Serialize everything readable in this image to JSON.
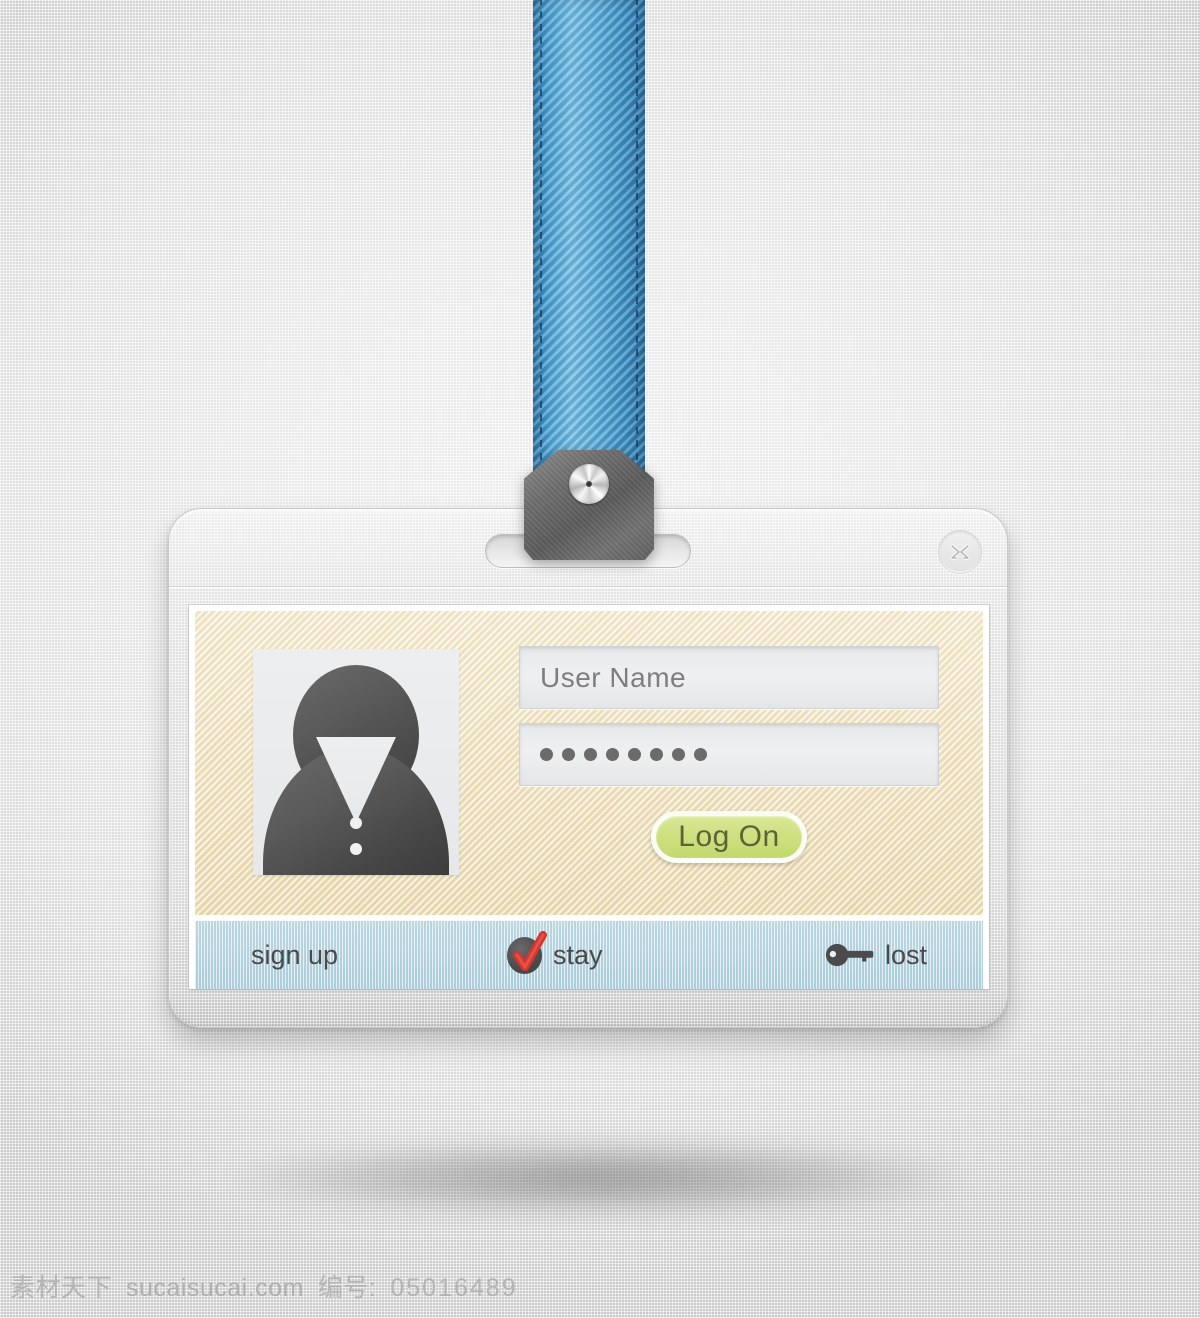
{
  "window": {
    "close_label": "×",
    "close_icon": "close-x-icon",
    "slot_label": "card-slot"
  },
  "lanyard": {
    "color": "#4ba3d8",
    "clip_color": "#6e6e6e",
    "rivet_color": "#e8e8e8"
  },
  "form": {
    "panel_color": "#f3e7c8",
    "avatar_alt": "default user avatar",
    "username": {
      "value": "",
      "placeholder": "User Name"
    },
    "password": {
      "value": "",
      "placeholder": "",
      "masked_char": "•",
      "masked_length": 8
    },
    "submit": {
      "label": "Log On",
      "color": "#cde07f",
      "text_color": "#5d6336"
    }
  },
  "footer": {
    "bar_color": "#c8e0e9",
    "items": [
      {
        "label": "sign up",
        "icon": ""
      },
      {
        "label": "stay",
        "icon": "red-check-icon"
      },
      {
        "label": "lost",
        "icon": "key-icon"
      }
    ]
  },
  "watermark": {
    "site_cn": "素材天下",
    "site": "sucaisucai.com",
    "number_label": "编号:",
    "number": "05016489"
  }
}
